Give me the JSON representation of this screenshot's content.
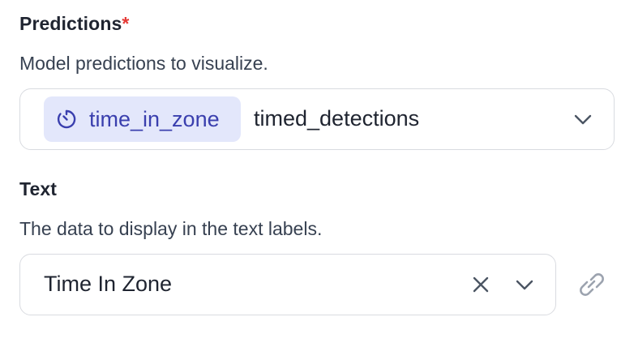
{
  "predictions": {
    "title": "Predictions",
    "required_mark": "*",
    "description": "Model predictions to visualize.",
    "tag_label": "time_in_zone",
    "tag_icon": "timer-icon",
    "value": "timed_detections"
  },
  "text": {
    "title": "Text",
    "description": "The data to display in the text labels.",
    "value": "Time In Zone"
  },
  "colors": {
    "accent": "#3a3fae",
    "tag_background": "#e3e7fb",
    "required": "#e53935",
    "border": "#d9dbe0"
  }
}
